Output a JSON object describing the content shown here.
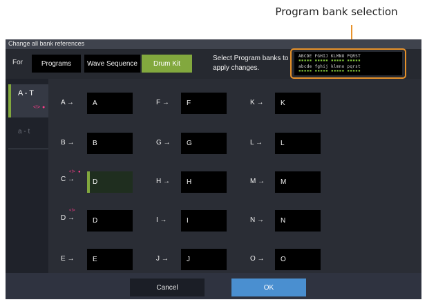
{
  "callout": {
    "text": "Program bank selection"
  },
  "dialog": {
    "title": "Change all bank references",
    "for_label": "For",
    "buttons": {
      "programs": "Programs",
      "wave_sequence": "Wave Sequence",
      "drum_kit": "Drum Kit"
    },
    "instruction": "Select Program banks to apply changes.",
    "bank_selector": {
      "row1_letters": "ABCDE FGHIJ KLMNO PQRST",
      "row2_letters": "abcde fghij klmno pqrst",
      "row1_dots": "▪▪▪▪▪ ▪▪▪▪▪ ▪▪▪▪▪ ▪▪▪▪▪",
      "row2_dots": "▪▪▪▪▪ ▪▪▪▪▪ ▪▪▪▪▪ ▪▪▪▪▪"
    }
  },
  "tabs": [
    {
      "label": "A - T",
      "marker": "<!>",
      "dot": "●"
    },
    {
      "label": "a - t"
    }
  ],
  "mappings": {
    "col1": [
      {
        "label": "A →",
        "value": "A"
      },
      {
        "label": "B →",
        "value": "B"
      },
      {
        "label": "C →",
        "value": "D",
        "marker": "<!>",
        "dot": "●"
      },
      {
        "label": "D →",
        "value": "D",
        "marker": "<!>"
      },
      {
        "label": "E →",
        "value": "E"
      }
    ],
    "col2": [
      {
        "label": "F →",
        "value": "F"
      },
      {
        "label": "G →",
        "value": "G"
      },
      {
        "label": "H →",
        "value": "H"
      },
      {
        "label": "I →",
        "value": "I"
      },
      {
        "label": "J →",
        "value": "J"
      }
    ],
    "col3": [
      {
        "label": "K →",
        "value": "K"
      },
      {
        "label": "L →",
        "value": "L"
      },
      {
        "label": "M →",
        "value": "M"
      },
      {
        "label": "N →",
        "value": "N"
      },
      {
        "label": "O →",
        "value": "O"
      }
    ]
  },
  "footer": {
    "cancel": "Cancel",
    "ok": "OK"
  },
  "colors": {
    "accent_green": "#82a83e",
    "callout_orange": "#e8922a",
    "ok_blue": "#4a8fd0",
    "marker_pink": "#ff3d8b"
  }
}
